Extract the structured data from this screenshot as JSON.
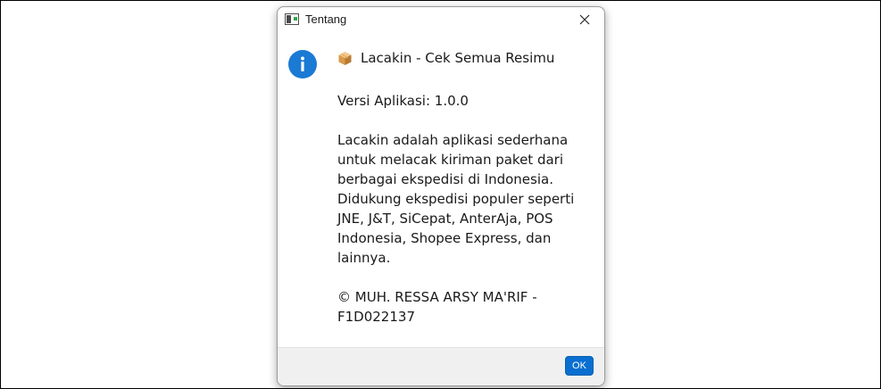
{
  "window": {
    "title": "Tentang"
  },
  "dialog": {
    "heading": "Lacakin - Cek Semua Resimu",
    "version": "Versi Aplikasi: 1.0.0",
    "description": "Lacakin adalah aplikasi sederhana untuk melacak kiriman paket dari berbagai ekspedisi di Indonesia. Didukung ekspedisi populer seperti JNE, J&T, SiCepat, AnterAja, POS Indonesia, Shopee Express, dan lainnya.",
    "copyright": "© MUH. RESSA ARSY MA'RIF - F1D022137",
    "ok_label": "OK"
  },
  "icons": {
    "info": "info-icon",
    "package": "package-icon",
    "close": "close-icon",
    "app": "app-window-icon"
  },
  "colors": {
    "info_blue": "#1a7ad4",
    "ok_button": "#0a6fd0",
    "footer_bg": "#f0f0f0"
  }
}
